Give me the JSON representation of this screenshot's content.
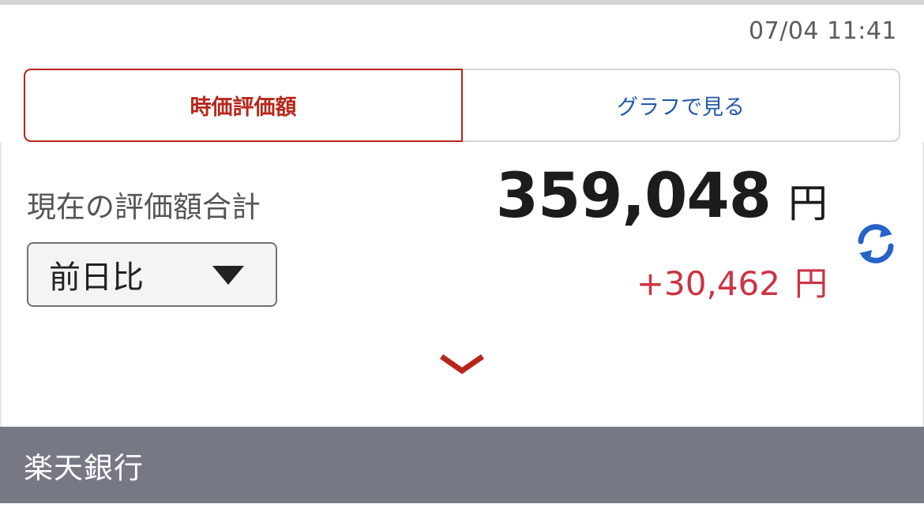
{
  "header": {
    "timestamp": "07/04 11:41"
  },
  "tabs": [
    {
      "label": "時価評価額",
      "active": true
    },
    {
      "label": "グラフで見る",
      "active": false
    }
  ],
  "summary": {
    "total_label": "現在の評価額合計",
    "total_value": "359,048",
    "total_unit": "円",
    "compare_selected": "前日比",
    "change_value": "+30,462",
    "change_unit": "円"
  },
  "icons": {
    "refresh": "refresh-icon",
    "expand": "chevron-down-icon",
    "dropdown": "caret-down-icon"
  },
  "section": {
    "bank_name": "楽天銀行"
  },
  "colors": {
    "active_tab": "#b8261b",
    "inactive_tab": "#2558a8",
    "change_positive": "#cc3344",
    "refresh_icon": "#2563c7",
    "section_header_bg": "#767984"
  }
}
